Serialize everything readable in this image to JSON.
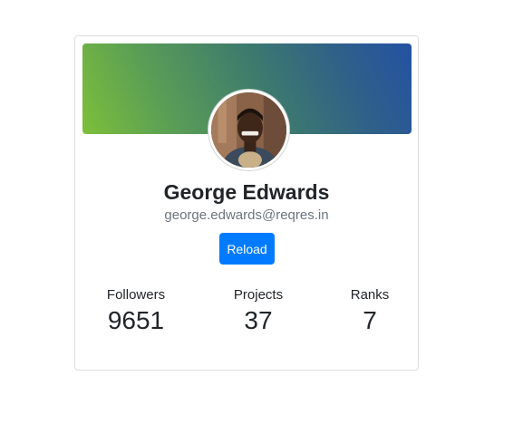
{
  "profile": {
    "name": "George Edwards",
    "email": "george.edwards@reqres.in",
    "reload_label": "Reload"
  },
  "stats": [
    {
      "label": "Followers",
      "value": "9651"
    },
    {
      "label": "Projects",
      "value": "37"
    },
    {
      "label": "Ranks",
      "value": "7"
    }
  ],
  "colors": {
    "banner_start": "#7dbf3a",
    "banner_end": "#2352a3",
    "button": "#007bff",
    "email": "#6c757d"
  },
  "icons": {
    "avatar": "user-photo"
  }
}
